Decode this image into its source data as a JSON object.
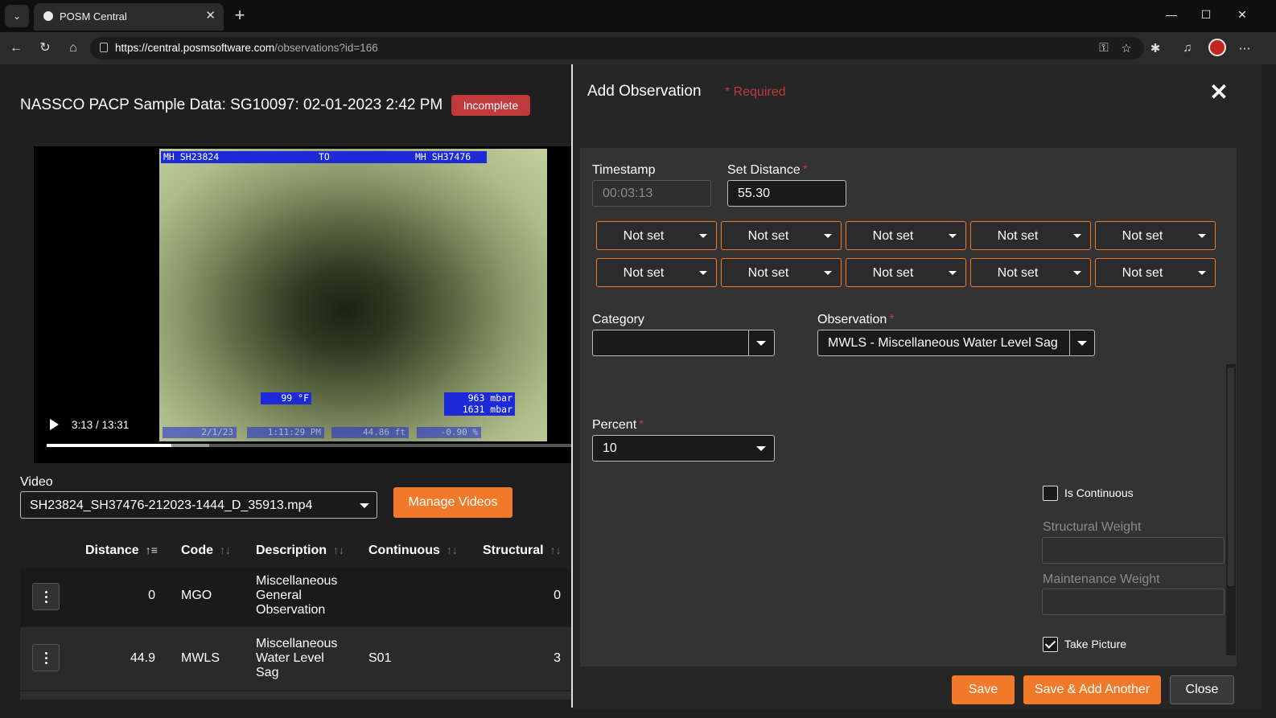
{
  "browser": {
    "tab_title": "POSM Central",
    "url_domain": "https://central.posmsoftware.com",
    "url_path": "/observations?id=166"
  },
  "page": {
    "title": "NASSCO PACP Sample Data: SG10097: 02-01-2023 2:42 PM",
    "status_badge": "Incomplete"
  },
  "video": {
    "overlay_top_left": "MH SH23824",
    "overlay_top_mid": "TO",
    "overlay_top_right": "MH SH37476",
    "overlay_temp": "99 °F",
    "overlay_pressure1": "963 mbar",
    "overlay_pressure2": "1631 mbar",
    "overlay_date": "2/1/23",
    "overlay_time": "1:11:29 PM",
    "overlay_dist": "44.86 ft",
    "overlay_pct": "-0.90 %",
    "time_display": "3:13 / 13:31",
    "progress_played": 0.238,
    "progress_buffered": 0.31
  },
  "video_selector": {
    "label": "Video",
    "value": "SH23824_SH37476-212023-1444_D_35913.mp4",
    "manage_label": "Manage Videos"
  },
  "table": {
    "headers": [
      "Distance",
      "Code",
      "Description",
      "Continuous",
      "Structural"
    ],
    "rows": [
      {
        "distance": "0",
        "code": "MGO",
        "desc1": "Miscellaneous",
        "desc2": "General",
        "desc3": "Observation",
        "continuous": "",
        "structural": "0"
      },
      {
        "distance": "44.9",
        "code": "MWLS",
        "desc1": "Miscellaneous",
        "desc2": "Water Level",
        "desc3": "Sag",
        "continuous": "S01",
        "structural": "3"
      }
    ]
  },
  "modal": {
    "title": "Add Observation",
    "required_note": "* Required",
    "timestamp_label": "Timestamp",
    "timestamp_value": "00:03:13",
    "distance_label": "Set Distance",
    "required_star": "*",
    "distance_value": "55.30",
    "dropdowns": [
      "Not set",
      "Not set",
      "Not set",
      "Not set",
      "Not set",
      "Not set",
      "Not set",
      "Not set",
      "Not set",
      "Not set"
    ],
    "category_label": "Category",
    "category_value": "",
    "observation_label": "Observation",
    "observation_value": "MWLS - Miscellaneous Water Level Sag",
    "percent_label": "Percent",
    "percent_value": "10",
    "is_continuous_label": "Is Continuous",
    "is_continuous_checked": false,
    "structural_weight_label": "Structural Weight",
    "maintenance_weight_label": "Maintenance Weight",
    "take_picture_label": "Take Picture",
    "take_picture_checked": true,
    "save_label": "Save",
    "save_add_label": "Save & Add Another",
    "close_label": "Close"
  },
  "colors": {
    "accent": "#f07a2a",
    "danger": "#c0393b",
    "background": "#1f1f1f",
    "modal": "#262626"
  }
}
